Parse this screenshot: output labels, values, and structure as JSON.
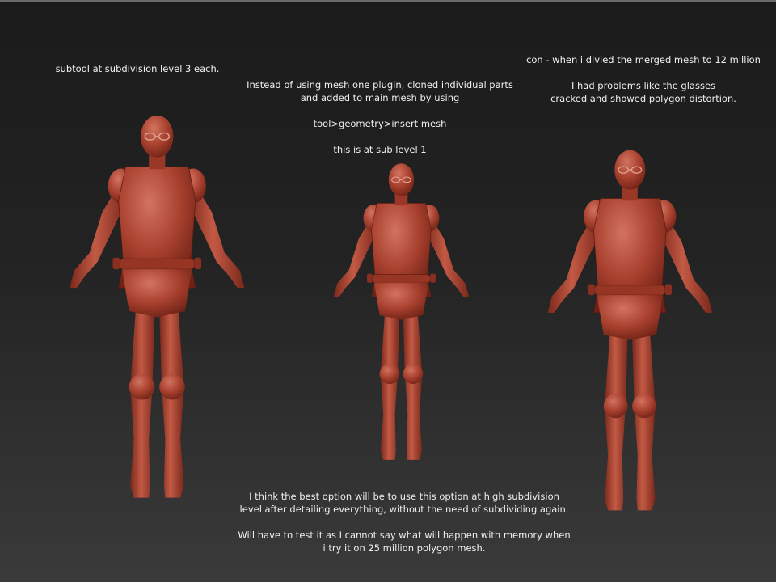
{
  "notes": {
    "left": "subtool at subdivision level 3 each.",
    "middle": "Instead of using mesh one plugin, cloned individual parts\nand added to main mesh by using\n\ntool>geometry>insert mesh\n\nthis is at sub level 1",
    "right": "con - when i divied the merged mesh to 12 million\n\nI had problems like the glasses\ncracked and showed polygon distortion.",
    "bottom": "I think the best option will be to use this option at high subdivision\nlevel after detailing everything, without the need of subdividing again.\n\nWill have to test it as I cannot say what will happen with memory when\ni try it on 25 million polygon mesh."
  },
  "colors": {
    "background_top": "#1b1b1b",
    "background_bottom": "#3a3a3a",
    "mesh_base": "#a8402e",
    "mesh_light": "#cf6a55",
    "mesh_dark": "#6e2216",
    "text": "#f0f0f0"
  },
  "figures": [
    {
      "id": "left",
      "description_icon": "sculpt-figure-icon"
    },
    {
      "id": "center",
      "description_icon": "sculpt-figure-icon"
    },
    {
      "id": "right",
      "description_icon": "sculpt-figure-icon"
    }
  ]
}
